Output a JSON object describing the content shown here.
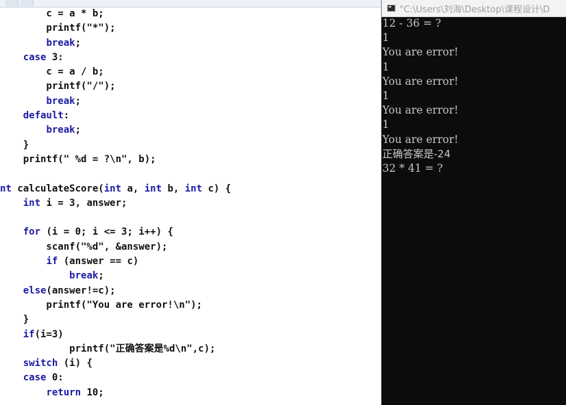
{
  "editor": {
    "lines": [
      {
        "tokens": [
          {
            "t": "        c = a * b;",
            "k": false
          }
        ]
      },
      {
        "tokens": [
          {
            "t": "        printf(\"*\");",
            "k": false
          }
        ]
      },
      {
        "tokens": [
          {
            "t": "        ",
            "k": false
          },
          {
            "t": "break",
            "k": true
          },
          {
            "t": ";",
            "k": false
          }
        ]
      },
      {
        "tokens": [
          {
            "t": "    ",
            "k": false
          },
          {
            "t": "case",
            "k": true
          },
          {
            "t": " 3:",
            "k": false
          }
        ]
      },
      {
        "tokens": [
          {
            "t": "        c = a / b;",
            "k": false
          }
        ]
      },
      {
        "tokens": [
          {
            "t": "        printf(\"/\");",
            "k": false
          }
        ]
      },
      {
        "tokens": [
          {
            "t": "        ",
            "k": false
          },
          {
            "t": "break",
            "k": true
          },
          {
            "t": ";",
            "k": false
          }
        ]
      },
      {
        "tokens": [
          {
            "t": "    ",
            "k": false
          },
          {
            "t": "default",
            "k": true
          },
          {
            "t": ":",
            "k": false
          }
        ]
      },
      {
        "tokens": [
          {
            "t": "        ",
            "k": false
          },
          {
            "t": "break",
            "k": true
          },
          {
            "t": ";",
            "k": false
          }
        ]
      },
      {
        "tokens": [
          {
            "t": "    }",
            "k": false
          }
        ]
      },
      {
        "tokens": [
          {
            "t": "    printf(\" %d = ?\\n\", b);",
            "k": false
          }
        ]
      },
      {
        "tokens": []
      },
      {
        "tokens": [
          {
            "t": "nt",
            "k": true
          },
          {
            "t": " calculateScore(",
            "k": false
          },
          {
            "t": "int",
            "k": true
          },
          {
            "t": " a, ",
            "k": false
          },
          {
            "t": "int",
            "k": true
          },
          {
            "t": " b, ",
            "k": false
          },
          {
            "t": "int",
            "k": true
          },
          {
            "t": " c) {",
            "k": false
          }
        ]
      },
      {
        "tokens": [
          {
            "t": "    ",
            "k": false
          },
          {
            "t": "int",
            "k": true
          },
          {
            "t": " i = 3, answer;",
            "k": false
          }
        ]
      },
      {
        "tokens": []
      },
      {
        "tokens": [
          {
            "t": "    ",
            "k": false
          },
          {
            "t": "for",
            "k": true
          },
          {
            "t": " (i = 0; i <= 3; i++) {",
            "k": false
          }
        ]
      },
      {
        "tokens": [
          {
            "t": "        scanf(\"%d\", &answer);",
            "k": false
          }
        ]
      },
      {
        "tokens": [
          {
            "t": "        ",
            "k": false
          },
          {
            "t": "if",
            "k": true
          },
          {
            "t": " (answer == c)",
            "k": false
          }
        ]
      },
      {
        "tokens": [
          {
            "t": "            ",
            "k": false
          },
          {
            "t": "break",
            "k": true
          },
          {
            "t": ";",
            "k": false
          }
        ]
      },
      {
        "tokens": [
          {
            "t": "    ",
            "k": false
          },
          {
            "t": "else",
            "k": true
          },
          {
            "t": "(answer!=c);",
            "k": false
          }
        ]
      },
      {
        "tokens": [
          {
            "t": "        printf(\"You are error!\\n\");",
            "k": false
          }
        ]
      },
      {
        "tokens": [
          {
            "t": "    }",
            "k": false
          }
        ]
      },
      {
        "tokens": [
          {
            "t": "    ",
            "k": false
          },
          {
            "t": "if",
            "k": true
          },
          {
            "t": "(i=3)",
            "k": false
          }
        ]
      },
      {
        "tokens": [
          {
            "t": "            printf(\"正确答案是%d\\n\",c);",
            "k": false
          }
        ]
      },
      {
        "tokens": [
          {
            "t": "    ",
            "k": false
          },
          {
            "t": "switch",
            "k": true
          },
          {
            "t": " (i) {",
            "k": false
          }
        ]
      },
      {
        "tokens": [
          {
            "t": "    ",
            "k": false
          },
          {
            "t": "case",
            "k": true
          },
          {
            "t": " 0:",
            "k": false
          }
        ]
      },
      {
        "tokens": [
          {
            "t": "        ",
            "k": false
          },
          {
            "t": "return",
            "k": true
          },
          {
            "t": " 10;",
            "k": false
          }
        ]
      }
    ]
  },
  "console": {
    "title": "\"C:\\Users\\刘海\\Desktop\\课程设计\\D",
    "icon": "console-app-icon",
    "lines": [
      "12 - 36 = ?",
      "1",
      "You are error!",
      "1",
      "You are error!",
      "1",
      "You are error!",
      "1",
      "You are error!",
      "正确答案是-24",
      "32 * 41 = ?"
    ]
  },
  "colors": {
    "keyword": "#1a1aa6",
    "code_text": "#111111",
    "console_bg": "#0c0c0c",
    "console_text": "#c7c7c7"
  }
}
